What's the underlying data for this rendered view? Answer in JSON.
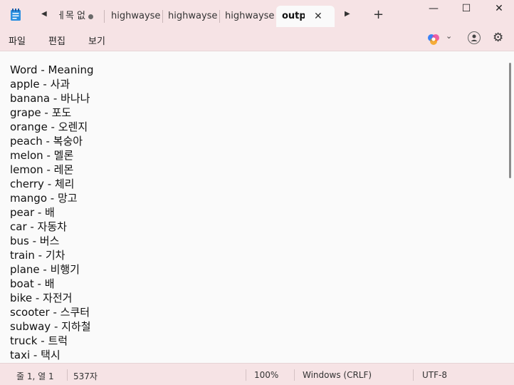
{
  "tabs": [
    {
      "label": "ㅔ목 없",
      "modified": true
    },
    {
      "label": "highwayseou"
    },
    {
      "label": "highwayseou"
    },
    {
      "label": "highwayseou"
    },
    {
      "label": "output",
      "active": true
    }
  ],
  "menu": {
    "file": "파일",
    "edit": "편집",
    "view": "보기"
  },
  "content": "Word - Meaning\napple - 사과\nbanana - 바나나\ngrape - 포도\norange - 오렌지\npeach - 복숭아\nmelon - 멜론\nlemon - 레몬\ncherry - 체리\nmango - 망고\npear - 배\ncar - 자동차\nbus - 버스\ntrain - 기차\nplane - 비행기\nboat - 배\nbike - 자전거\nscooter - 스쿠터\nsubway - 지하철\ntruck - 트럭\ntaxi - 택시",
  "status": {
    "position": "줄 1, 열 1",
    "chars": "537자",
    "zoom": "100%",
    "line_ending": "Windows (CRLF)",
    "encoding": "UTF-8"
  },
  "icons": {
    "app": "notepad-icon",
    "scroll_left": "triangle-left-icon",
    "scroll_right": "triangle-right-icon",
    "new_tab": "plus-icon",
    "close": "close-icon",
    "minimize": "minimize-icon",
    "maximize": "maximize-icon",
    "window_close": "close-icon",
    "copilot": "copilot-icon",
    "account": "account-icon",
    "settings": "gear-icon"
  },
  "colors": {
    "chrome": "#f6e3e5",
    "editor": "#fafafa"
  }
}
